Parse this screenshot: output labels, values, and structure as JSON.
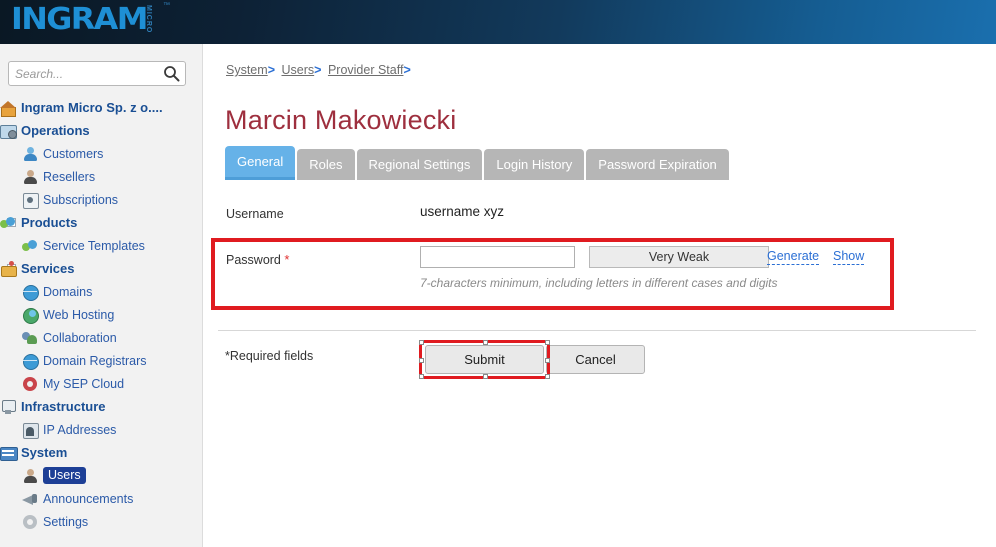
{
  "header": {
    "logo_text": "INGRAM",
    "logo_sub": "MICRO",
    "logo_tm": "™"
  },
  "sidebar": {
    "search": {
      "placeholder": "Search...",
      "value": "",
      "icon": "search-icon"
    },
    "items": [
      {
        "label": "Ingram Micro Sp. z o....",
        "level": 0,
        "icon": "home-icon",
        "expander": "",
        "selected": false
      },
      {
        "label": "Operations",
        "level": 0,
        "icon": "operations-icon",
        "expander": "−",
        "selected": false
      },
      {
        "label": "Customers",
        "level": 1,
        "icon": "customers-icon",
        "expander": "",
        "selected": false
      },
      {
        "label": "Resellers",
        "level": 1,
        "icon": "resellers-icon",
        "expander": "",
        "selected": false
      },
      {
        "label": "Subscriptions",
        "level": 1,
        "icon": "subscriptions-icon",
        "expander": "",
        "selected": false
      },
      {
        "label": "Products",
        "level": 0,
        "icon": "products-icon",
        "expander": "−",
        "selected": false
      },
      {
        "label": "Service Templates",
        "level": 1,
        "icon": "service-templates-icon",
        "expander": "",
        "selected": false
      },
      {
        "label": "Services",
        "level": 0,
        "icon": "services-icon",
        "expander": "−",
        "selected": false
      },
      {
        "label": "Domains",
        "level": 1,
        "icon": "domains-icon",
        "expander": "",
        "selected": false
      },
      {
        "label": "Web Hosting",
        "level": 1,
        "icon": "web-hosting-icon",
        "expander": "",
        "selected": false
      },
      {
        "label": "Collaboration",
        "level": 1,
        "icon": "collaboration-icon",
        "expander": "",
        "selected": false
      },
      {
        "label": "Domain Registrars",
        "level": 1,
        "icon": "domain-registrars-icon",
        "expander": "",
        "selected": false
      },
      {
        "label": "My SEP Cloud",
        "level": 1,
        "icon": "my-sep-cloud-icon",
        "expander": "",
        "selected": false
      },
      {
        "label": "Infrastructure",
        "level": 0,
        "icon": "infrastructure-icon",
        "expander": "−",
        "selected": false
      },
      {
        "label": "IP Addresses",
        "level": 1,
        "icon": "ip-addresses-icon",
        "expander": "",
        "selected": false
      },
      {
        "label": "System",
        "level": 0,
        "icon": "system-icon",
        "expander": "−",
        "selected": false
      },
      {
        "label": "Users",
        "level": 1,
        "icon": "users-icon",
        "expander": "",
        "selected": true
      },
      {
        "label": "Announcements",
        "level": 1,
        "icon": "announcements-icon",
        "expander": "",
        "selected": false
      },
      {
        "label": "Settings",
        "level": 1,
        "icon": "settings-icon",
        "expander": "",
        "selected": false
      }
    ]
  },
  "content": {
    "breadcrumb": [
      {
        "label": "System",
        "sep": ">"
      },
      {
        "label": "Users",
        "sep": ">"
      },
      {
        "label": "Provider Staff",
        "sep": ">"
      }
    ],
    "page_title": "Marcin Makowiecki",
    "tabs": [
      {
        "label": "General",
        "active": true
      },
      {
        "label": "Roles",
        "active": false
      },
      {
        "label": "Regional Settings",
        "active": false
      },
      {
        "label": "Login History",
        "active": false
      },
      {
        "label": "Password Expiration",
        "active": false
      }
    ],
    "form": {
      "username_label": "Username",
      "username_value": "username xyz",
      "password_label": "Password",
      "required_marker": "*",
      "password_value": "",
      "password_placeholder": "",
      "strength_label": "Very Weak",
      "generate_link": "Generate",
      "show_link": "Show",
      "password_hint": "7-characters minimum, including letters in different cases and digits",
      "required_fields_note": "*Required fields",
      "submit_label": "Submit",
      "cancel_label": "Cancel"
    }
  },
  "colors": {
    "header_dark": "#0a1824",
    "header_light": "#1a6fae",
    "logo_blue": "#1e8fd5",
    "title_maroon": "#9e2f3e",
    "tab_active": "#66b2e8",
    "tab_inactive": "#b6b6b6",
    "highlight_red": "#e01b20",
    "selected_nav": "#1d3f96",
    "link_blue": "#2b6fd4"
  }
}
